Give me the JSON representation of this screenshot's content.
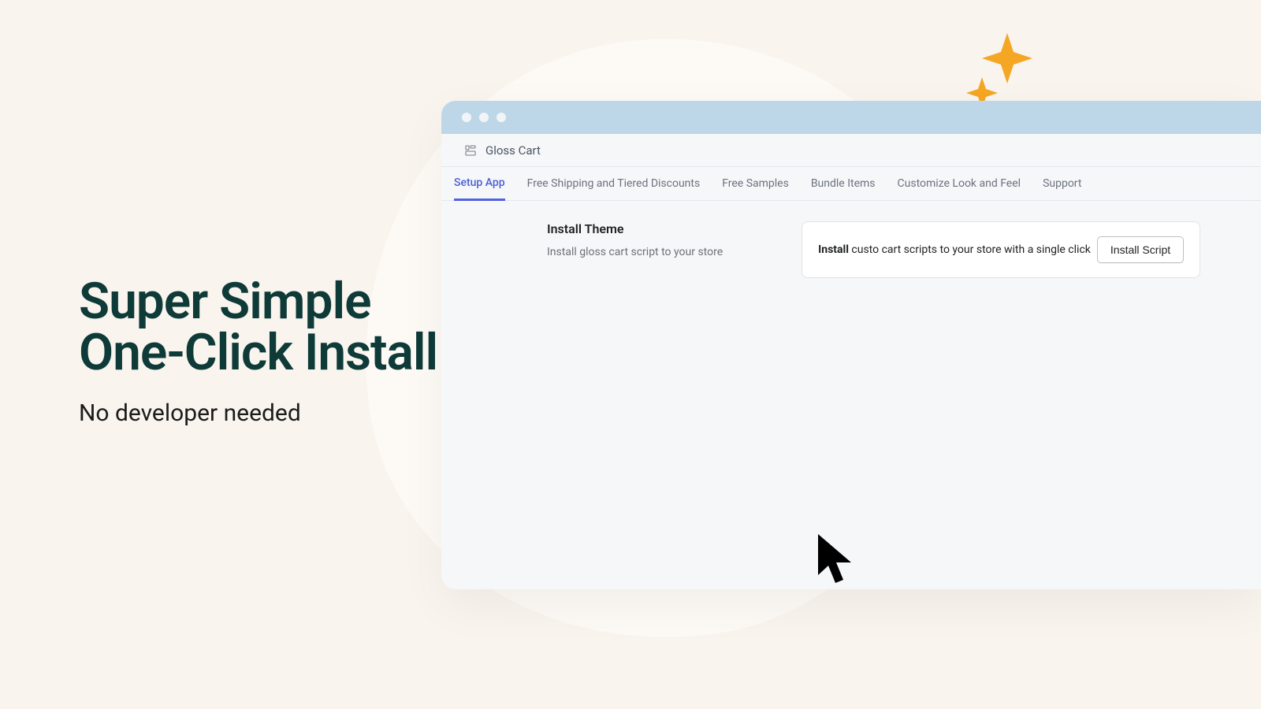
{
  "hero": {
    "title_line1": "Super Simple",
    "title_line2": "One-Click Install",
    "subtitle": "No developer needed"
  },
  "app": {
    "name": "Gloss Cart"
  },
  "tabs": [
    {
      "label": "Setup App",
      "active": true
    },
    {
      "label": "Free Shipping and Tiered Discounts",
      "active": false
    },
    {
      "label": "Free Samples",
      "active": false
    },
    {
      "label": "Bundle Items",
      "active": false
    },
    {
      "label": "Customize Look and Feel",
      "active": false
    },
    {
      "label": "Support",
      "active": false
    }
  ],
  "section": {
    "title": "Install Theme",
    "subtitle": "Install gloss cart script to your store"
  },
  "card": {
    "bold": "Install",
    "rest": " custo cart scripts to your store with a single click",
    "button": "Install Script"
  },
  "colors": {
    "accent": "#5262e0",
    "sparkle": "#f5a623",
    "titlebar": "#bed7e8",
    "heroText": "#0e3a38"
  }
}
